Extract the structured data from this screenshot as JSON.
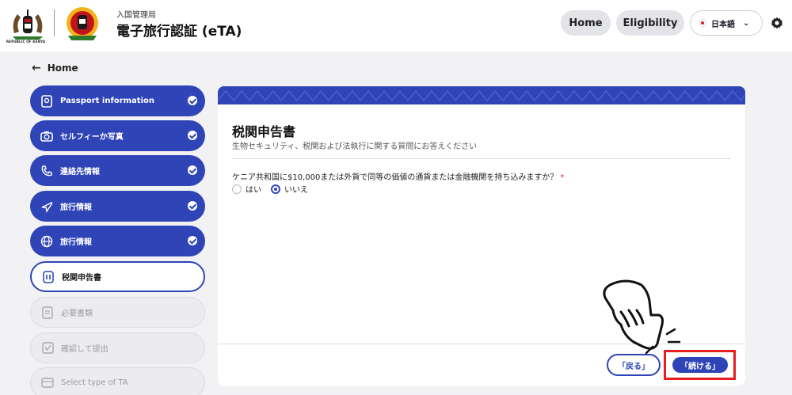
{
  "header": {
    "coat_caption": "REPUBLIC OF KENYA",
    "subtitle": "入国管理局",
    "title": "電子旅行認証 (eTA)",
    "nav": {
      "home": "Home",
      "eligibility": "Eligibility"
    },
    "language": "日本語"
  },
  "back_link": {
    "label": "Home"
  },
  "steps": [
    {
      "label": "Passport information",
      "state": "done",
      "icon": "passport-icon"
    },
    {
      "label": "セルフィーか写真",
      "state": "done",
      "icon": "camera-icon"
    },
    {
      "label": "連絡先情報",
      "state": "done",
      "icon": "phone-icon"
    },
    {
      "label": "旅行情報",
      "state": "done",
      "icon": "plane-icon"
    },
    {
      "label": "旅行情報",
      "state": "done",
      "icon": "globe-icon"
    },
    {
      "label": "税関申告書",
      "state": "current",
      "icon": "customs-icon"
    },
    {
      "label": "必要書類",
      "state": "pending",
      "icon": "document-icon"
    },
    {
      "label": "確認して提出",
      "state": "pending",
      "icon": "checkbox-icon"
    },
    {
      "label": "Select type of TA",
      "state": "pending",
      "icon": "card-icon"
    }
  ],
  "form": {
    "title": "税関申告書",
    "subtitle": "生物セキュリティ、税関および法執行に関する質問にお答えください",
    "question": "ケニア共和国に$10,000または外貨で同等の価値の通貨または金融機関を持ち込みますか？",
    "required_mark": "*",
    "options": [
      {
        "label": "はい",
        "selected": false
      },
      {
        "label": "いいえ",
        "selected": true
      }
    ],
    "back_button": "「戻る」",
    "next_button": "「続ける」"
  },
  "colors": {
    "primary": "#2f45b7",
    "highlight": "#e61e1e",
    "background": "#f2f2f4"
  }
}
